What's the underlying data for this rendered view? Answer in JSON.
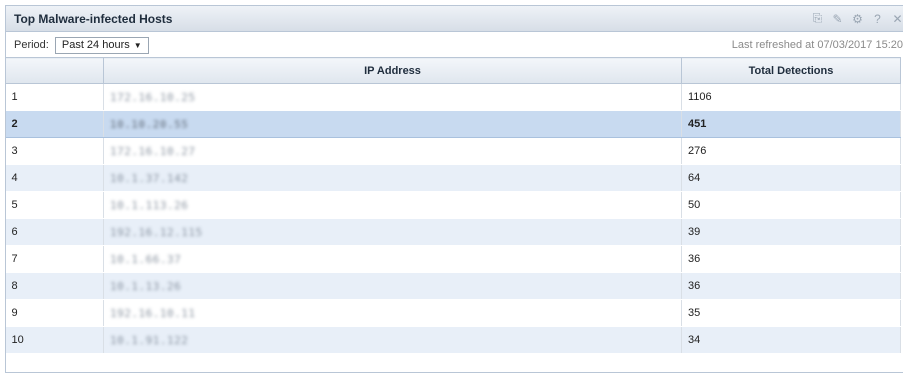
{
  "widget": {
    "title": "Top Malware-infected Hosts",
    "tools": [
      "export-icon",
      "edit-icon",
      "settings-icon",
      "help-icon",
      "close-icon"
    ],
    "tool_glyphs": [
      "⎘",
      "✎",
      "⚙",
      "?",
      "✕"
    ]
  },
  "toolbar": {
    "period_label": "Period:",
    "period_value": "Past 24 hours",
    "dropdown_arrow": "▼",
    "refreshed": "Last refreshed at 07/03/2017 15:20"
  },
  "table": {
    "columns": [
      "",
      "IP Address",
      "Total Detections"
    ],
    "rows": [
      {
        "rank": "1",
        "ip": "172.16.10.25",
        "detections": "1106"
      },
      {
        "rank": "2",
        "ip": "10.10.20.55",
        "detections": "451"
      },
      {
        "rank": "3",
        "ip": "172.16.10.27",
        "detections": "276"
      },
      {
        "rank": "4",
        "ip": "10.1.37.142",
        "detections": "64"
      },
      {
        "rank": "5",
        "ip": "10.1.113.26",
        "detections": "50"
      },
      {
        "rank": "6",
        "ip": "192.16.12.115",
        "detections": "39"
      },
      {
        "rank": "7",
        "ip": "10.1.66.37",
        "detections": "36"
      },
      {
        "rank": "8",
        "ip": "10.1.13.26",
        "detections": "36"
      },
      {
        "rank": "9",
        "ip": "192.16.10.11",
        "detections": "35"
      },
      {
        "rank": "10",
        "ip": "10.1.91.122",
        "detections": "34"
      }
    ],
    "selected_index": 1
  }
}
